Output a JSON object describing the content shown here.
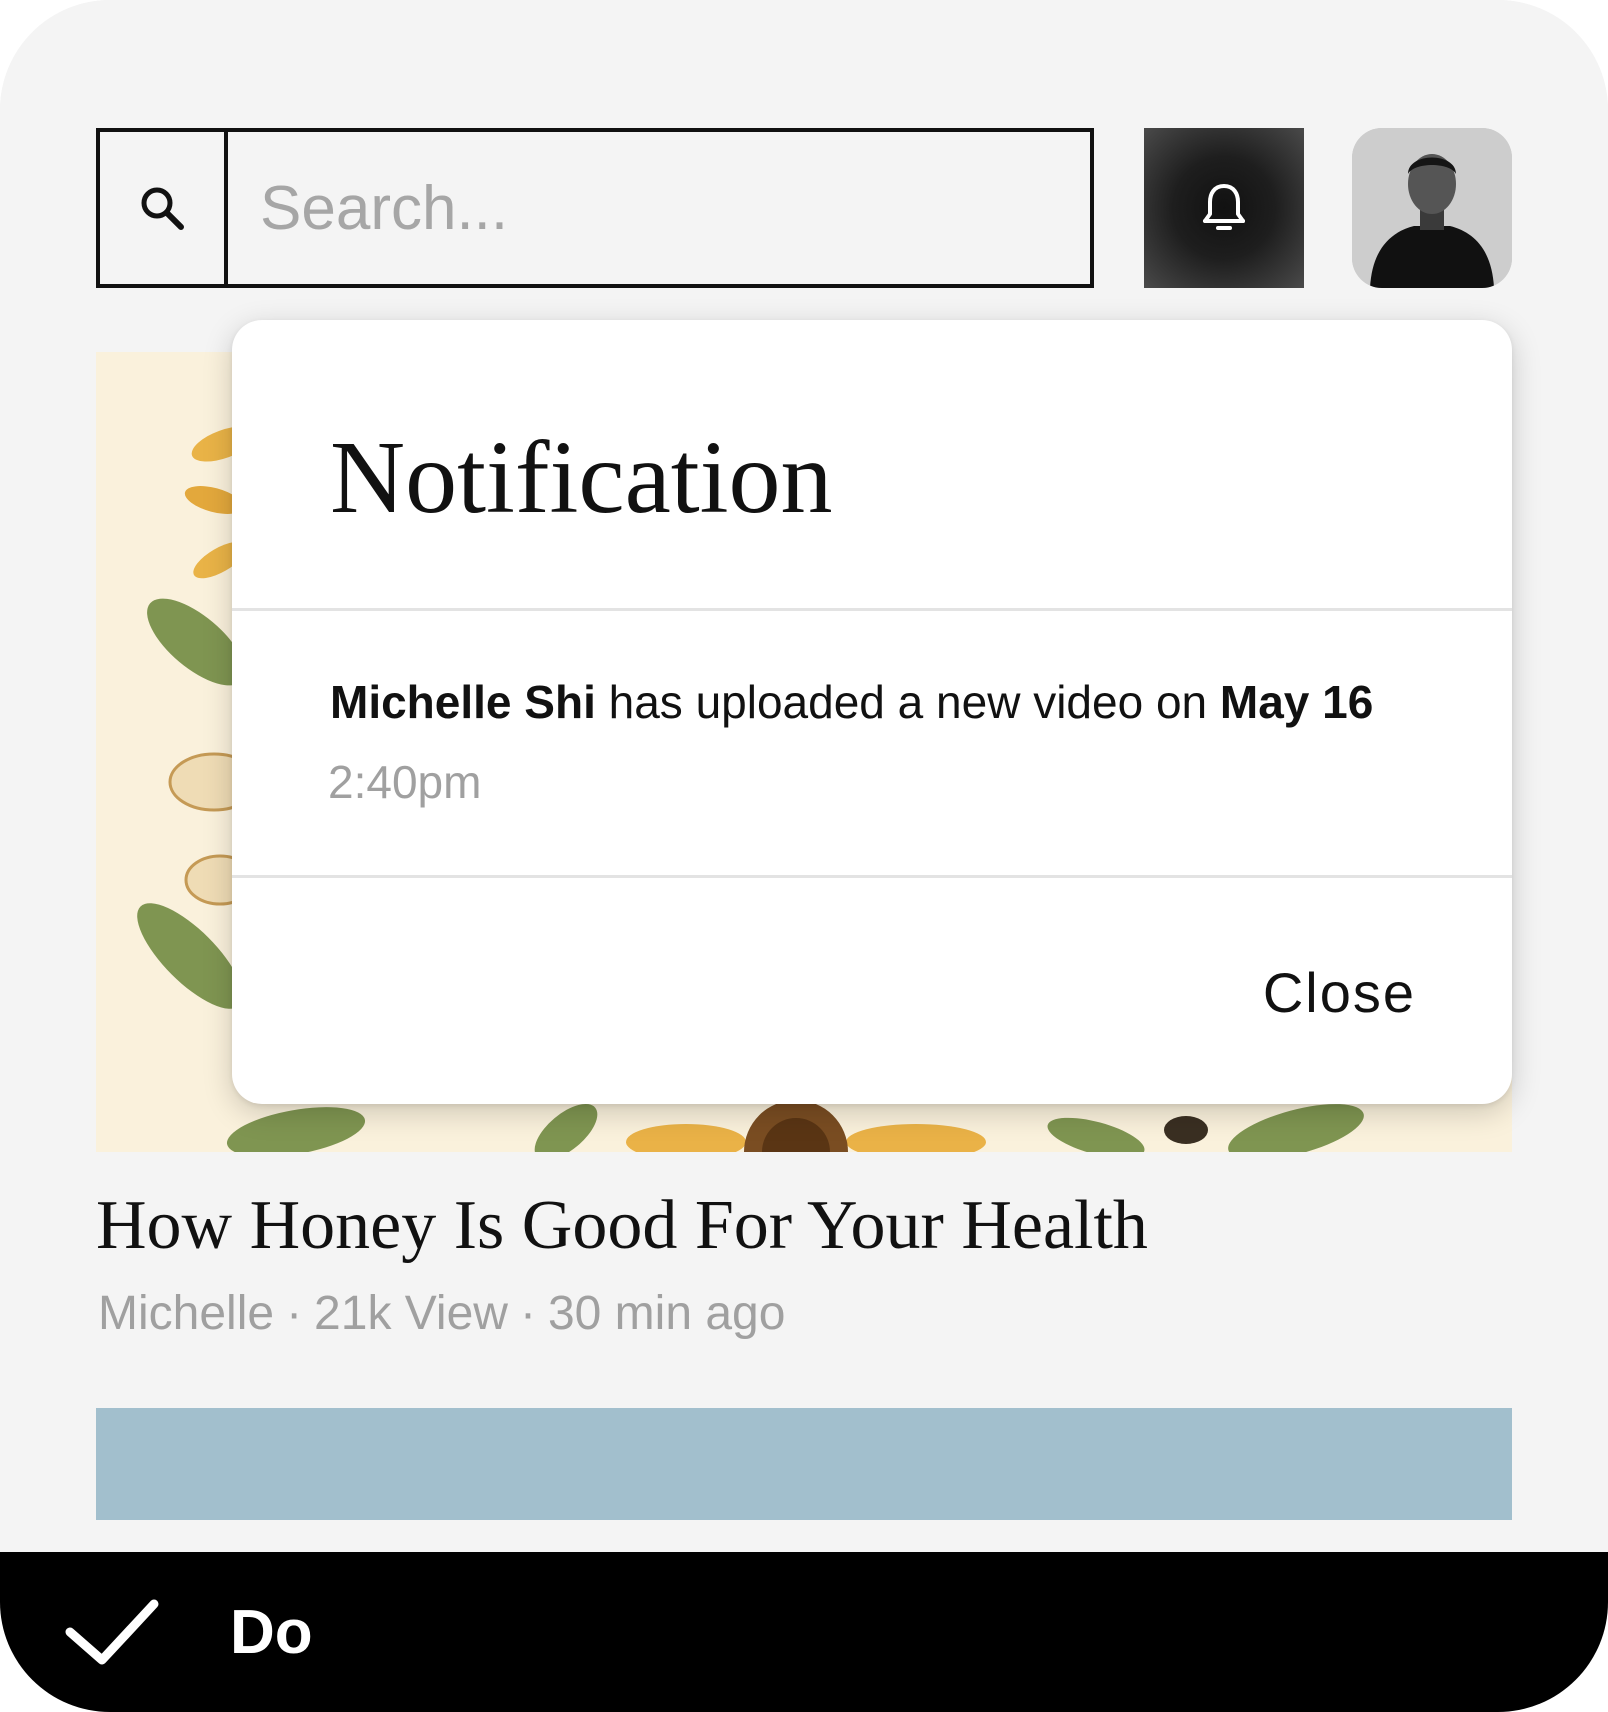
{
  "search": {
    "placeholder": "Search..."
  },
  "header": {
    "bell_icon": "bell-icon",
    "avatar": "user-avatar"
  },
  "article": {
    "title": "How Honey Is Good For Your Health",
    "author": "Michelle",
    "views": "21k View",
    "time_ago": "30 min ago",
    "separator": "·"
  },
  "notification": {
    "title": "Notification",
    "sender": "Michelle Shi",
    "message": " has uploaded a new video on ",
    "date": "May 16",
    "time": "2:40pm",
    "close_label": "Close"
  },
  "footer": {
    "status_icon": "check-icon",
    "label": "Do"
  },
  "colors": {
    "background": "#f4f4f4",
    "bell_button": "#1e1e1e",
    "bottom_bar": "#000000",
    "meta_text": "#a0a0a0",
    "next_card": "#a2bfcd"
  }
}
